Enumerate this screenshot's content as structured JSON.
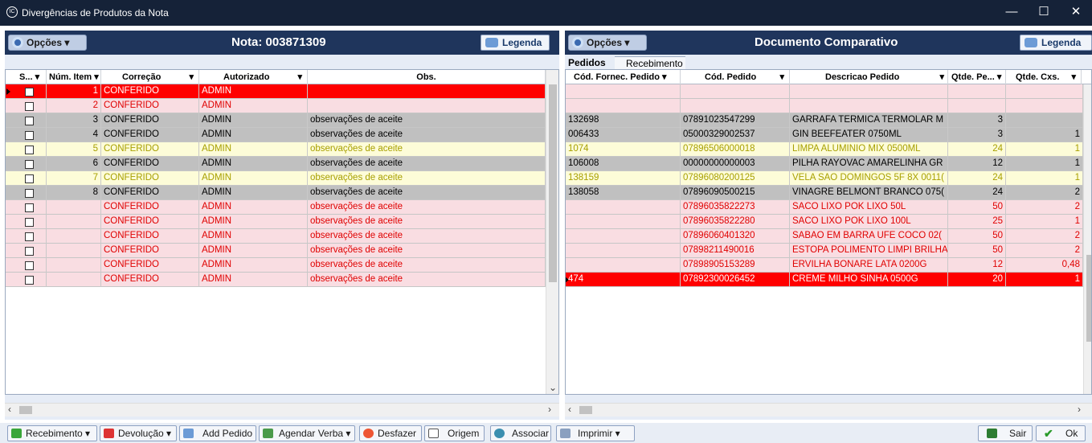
{
  "window": {
    "title": "Divergências de Produtos da Nota",
    "app_icon": "IC",
    "min": "—",
    "max": "☐",
    "close": "✕"
  },
  "left": {
    "options_label": "Opções",
    "title": "Nota: 003871309",
    "legend_label": "Legenda",
    "columns": [
      "S...",
      "Núm. Item",
      "Correção",
      "Autorizado",
      "Obs."
    ],
    "rows": [
      {
        "num": "1",
        "correcao": "CONFERIDO",
        "autorizado": "ADMIN",
        "obs": "",
        "style": "red"
      },
      {
        "num": "2",
        "correcao": "CONFERIDO",
        "autorizado": "ADMIN",
        "obs": "",
        "style": "pink"
      },
      {
        "num": "3",
        "correcao": "CONFERIDO",
        "autorizado": "ADMIN",
        "obs": "observações de aceite",
        "style": "gray"
      },
      {
        "num": "4",
        "correcao": "CONFERIDO",
        "autorizado": "ADMIN",
        "obs": "observações de aceite",
        "style": "gray"
      },
      {
        "num": "5",
        "correcao": "CONFERIDO",
        "autorizado": "ADMIN",
        "obs": "observações de aceite",
        "style": "yellow"
      },
      {
        "num": "6",
        "correcao": "CONFERIDO",
        "autorizado": "ADMIN",
        "obs": "observações de aceite",
        "style": "gray"
      },
      {
        "num": "7",
        "correcao": "CONFERIDO",
        "autorizado": "ADMIN",
        "obs": "observações de aceite",
        "style": "yellow"
      },
      {
        "num": "8",
        "correcao": "CONFERIDO",
        "autorizado": "ADMIN",
        "obs": "observações de aceite",
        "style": "gray"
      },
      {
        "num": "",
        "correcao": "CONFERIDO",
        "autorizado": "ADMIN",
        "obs": "observações de aceite",
        "style": "pink"
      },
      {
        "num": "",
        "correcao": "CONFERIDO",
        "autorizado": "ADMIN",
        "obs": "observações de aceite",
        "style": "pink"
      },
      {
        "num": "",
        "correcao": "CONFERIDO",
        "autorizado": "ADMIN",
        "obs": "observações de aceite",
        "style": "pink"
      },
      {
        "num": "",
        "correcao": "CONFERIDO",
        "autorizado": "ADMIN",
        "obs": "observações de aceite",
        "style": "pink"
      },
      {
        "num": "",
        "correcao": "CONFERIDO",
        "autorizado": "ADMIN",
        "obs": "observações de aceite",
        "style": "pink"
      },
      {
        "num": "",
        "correcao": "CONFERIDO",
        "autorizado": "ADMIN",
        "obs": "observações de aceite",
        "style": "pink"
      }
    ]
  },
  "right": {
    "options_label": "Opções",
    "title": "Documento Comparativo",
    "legend_label": "Legenda",
    "tabs": [
      "Pedidos",
      "Recebimento"
    ],
    "columns": [
      "Cód. Fornec. Pedido",
      "Cód. Pedido",
      "Descricao Pedido",
      "Qtde. Pe...",
      "Qtde. Cxs."
    ],
    "rows": [
      {
        "forn": "",
        "ped": "",
        "desc": "",
        "qp": "",
        "qc": "",
        "style": "pink"
      },
      {
        "forn": "",
        "ped": "",
        "desc": "",
        "qp": "",
        "qc": "",
        "style": "pink"
      },
      {
        "forn": "132698",
        "ped": "07891023547299",
        "desc": "GARRAFA TERMICA TERMOLAR M",
        "qp": "3",
        "qc": "",
        "style": "gray"
      },
      {
        "forn": "006433",
        "ped": "05000329002537",
        "desc": "GIN BEEFEATER 0750ML",
        "qp": "3",
        "qc": "1",
        "style": "gray"
      },
      {
        "forn": "1074",
        "ped": "07896506000018",
        "desc": "LIMPA ALUMINIO MIX 0500ML",
        "qp": "24",
        "qc": "1",
        "style": "yellow"
      },
      {
        "forn": "106008",
        "ped": "00000000000003",
        "desc": "PILHA RAYOVAC AMARELINHA GR",
        "qp": "12",
        "qc": "1",
        "style": "gray"
      },
      {
        "forn": "138159",
        "ped": "07896080200125",
        "desc": "VELA SAO DOMINGOS 5F 8X 0011(",
        "qp": "24",
        "qc": "1",
        "style": "yellow"
      },
      {
        "forn": "138058",
        "ped": "07896090500215",
        "desc": "VINAGRE BELMONT BRANCO 075(",
        "qp": "24",
        "qc": "2",
        "style": "gray"
      },
      {
        "forn": "",
        "ped": "07896035822273",
        "desc": "SACO LIXO POK LIXO 50L",
        "qp": "50",
        "qc": "2",
        "style": "pink"
      },
      {
        "forn": "",
        "ped": "07896035822280",
        "desc": "SACO LIXO POK LIXO 100L",
        "qp": "25",
        "qc": "1",
        "style": "pink"
      },
      {
        "forn": "",
        "ped": "07896060401320",
        "desc": "SABAO EM BARRA UFE COCO 02(",
        "qp": "50",
        "qc": "2",
        "style": "pink"
      },
      {
        "forn": "",
        "ped": "07898211490016",
        "desc": "ESTOPA POLIMENTO LIMPI BRILHA",
        "qp": "50",
        "qc": "2",
        "style": "pink"
      },
      {
        "forn": "",
        "ped": "07898905153289",
        "desc": "ERVILHA BONARE LATA 0200G",
        "qp": "12",
        "qc": "0,48",
        "style": "pink"
      },
      {
        "forn": "474",
        "ped": "07892300026452",
        "desc": "CREME MILHO SINHA 0500G",
        "qp": "20",
        "qc": "1",
        "style": "red"
      }
    ]
  },
  "toolbar": {
    "recebimento": "Recebimento",
    "devolucao": "Devolução",
    "add_pedido": "Add Pedido",
    "agendar_verba": "Agendar Verba",
    "desfazer": "Desfazer",
    "origem": "Origem",
    "associar": "Associar",
    "imprimir": "Imprimir",
    "sair": "Sair",
    "ok": "Ok"
  },
  "colors": {
    "red": "#ff0000",
    "pink": "#f9dde2",
    "gray": "#c0c0c0",
    "yellow": "#fdfcd8",
    "title_bar": "#152238",
    "panel_bar": "#1f355c"
  }
}
